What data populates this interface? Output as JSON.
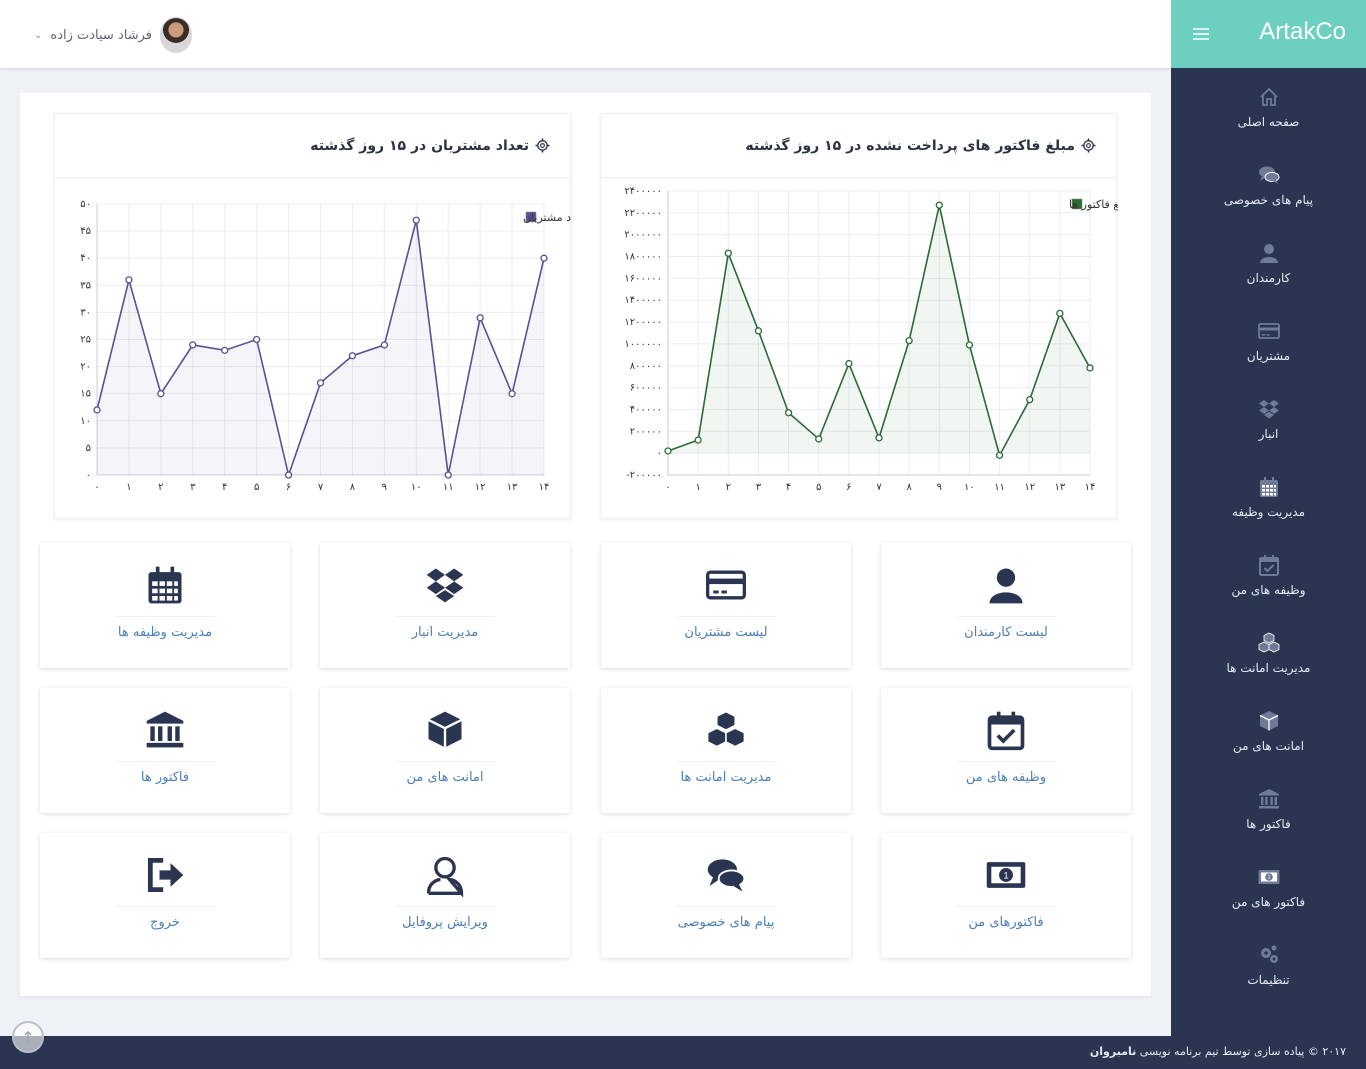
{
  "header": {
    "user_name": "فرشاد سیادت زاده",
    "caret": "⌄"
  },
  "brand": {
    "name": "ArtakCo"
  },
  "sidebar": {
    "items": [
      {
        "label": "صفحه اصلی",
        "icon": "home-icon"
      },
      {
        "label": "پیام های خصوصی",
        "icon": "comments-icon"
      },
      {
        "label": "کارمندان",
        "icon": "user-icon"
      },
      {
        "label": "مشتریان",
        "icon": "credit-card-icon"
      },
      {
        "label": "انبار",
        "icon": "dropbox-icon"
      },
      {
        "label": "مدیریت وظیفه",
        "icon": "calendar-icon"
      },
      {
        "label": "وظیفه های من",
        "icon": "calendar-check-icon"
      },
      {
        "label": "مدیریت امانت ها",
        "icon": "cubes-icon"
      },
      {
        "label": "امانت های من",
        "icon": "cube-icon"
      },
      {
        "label": "فاکتور ها",
        "icon": "bank-icon"
      },
      {
        "label": "فاکتور های من",
        "icon": "money-icon"
      },
      {
        "label": "تنظیمات",
        "icon": "gears-icon"
      }
    ]
  },
  "tiles": [
    {
      "label": "لیست کارمندان",
      "icon": "user-icon"
    },
    {
      "label": "لیست مشتریان",
      "icon": "credit-card-icon"
    },
    {
      "label": "مدیریت انبار",
      "icon": "dropbox-icon"
    },
    {
      "label": "مدیریت وظیفه ها",
      "icon": "calendar-icon"
    },
    {
      "label": "وظیفه های من",
      "icon": "calendar-check-icon"
    },
    {
      "label": "مدیریت امانت ها",
      "icon": "cubes-icon"
    },
    {
      "label": "امانت های من",
      "icon": "cube-icon"
    },
    {
      "label": "فاکتور ها",
      "icon": "bank-icon"
    },
    {
      "label": "فاکتورهای من",
      "icon": "money-icon"
    },
    {
      "label": "پیام های خصوصی",
      "icon": "comments-icon"
    },
    {
      "label": "ویرایش پروفایل",
      "icon": "user-outline-icon"
    },
    {
      "label": "خروج",
      "icon": "sign-out-icon"
    }
  ],
  "footer": {
    "prefix": "۲۰۱۷ © پیاده سازی توسط تیم برنامه نویسی",
    "team": "نامبروان"
  },
  "colors": {
    "sidebar_bg": "#2a3651",
    "brand_bg": "#6ccfc0",
    "customers_line": "#5b4f96",
    "invoices_line": "#2a6b34",
    "tile_icon": "#2a3651",
    "tile_label": "#4a7fb5"
  },
  "chart_data": [
    {
      "type": "line",
      "title": "مبلغ فاکتور های پرداخت نشده در ۱۵ روز گذشته",
      "series": [
        {
          "name": "جمع مبلغ فاکتور ها",
          "values": [
            20000,
            120000,
            1830000,
            1120000,
            370000,
            130000,
            820000,
            140000,
            1030000,
            2270000,
            990000,
            -20000,
            490000,
            1280000,
            780000
          ]
        }
      ],
      "x": [
        "۰",
        "۱",
        "۲",
        "۳",
        "۴",
        "۵",
        "۶",
        "۷",
        "۸",
        "۹",
        "۱۰",
        "۱۱",
        "۱۲",
        "۱۳",
        "۱۴"
      ],
      "y_ticks": [
        "-۲۰۰۰۰۰",
        "۰",
        "۲۰۰۰۰۰",
        "۴۰۰۰۰۰",
        "۶۰۰۰۰۰",
        "۸۰۰۰۰۰",
        "۱۰۰۰۰۰۰",
        "۱۲۰۰۰۰۰",
        "۱۴۰۰۰۰۰",
        "۱۶۰۰۰۰۰",
        "۱۸۰۰۰۰۰",
        "۲۰۰۰۰۰۰",
        "۲۲۰۰۰۰۰",
        "۲۴۰۰۰۰۰"
      ],
      "ylim": [
        -200000,
        2400000
      ],
      "grid": true,
      "legend": "top-right"
    },
    {
      "type": "line",
      "title": "تعداد مشتریان در ۱۵ روز گذشته",
      "series": [
        {
          "name": "تعداد مشتریان",
          "values": [
            12,
            36,
            15,
            24,
            23,
            25,
            0,
            17,
            22,
            24,
            47,
            0,
            29,
            15,
            40
          ]
        }
      ],
      "x": [
        "۰",
        "۱",
        "۲",
        "۳",
        "۴",
        "۵",
        "۶",
        "۷",
        "۸",
        "۹",
        "۱۰",
        "۱۱",
        "۱۲",
        "۱۳",
        "۱۴"
      ],
      "y_ticks": [
        "۰",
        "۵",
        "۱۰",
        "۱۵",
        "۲۰",
        "۲۵",
        "۳۰",
        "۳۵",
        "۴۰",
        "۴۵",
        "۵۰"
      ],
      "ylim": [
        0,
        50
      ],
      "grid": true,
      "legend": "top-right"
    }
  ]
}
